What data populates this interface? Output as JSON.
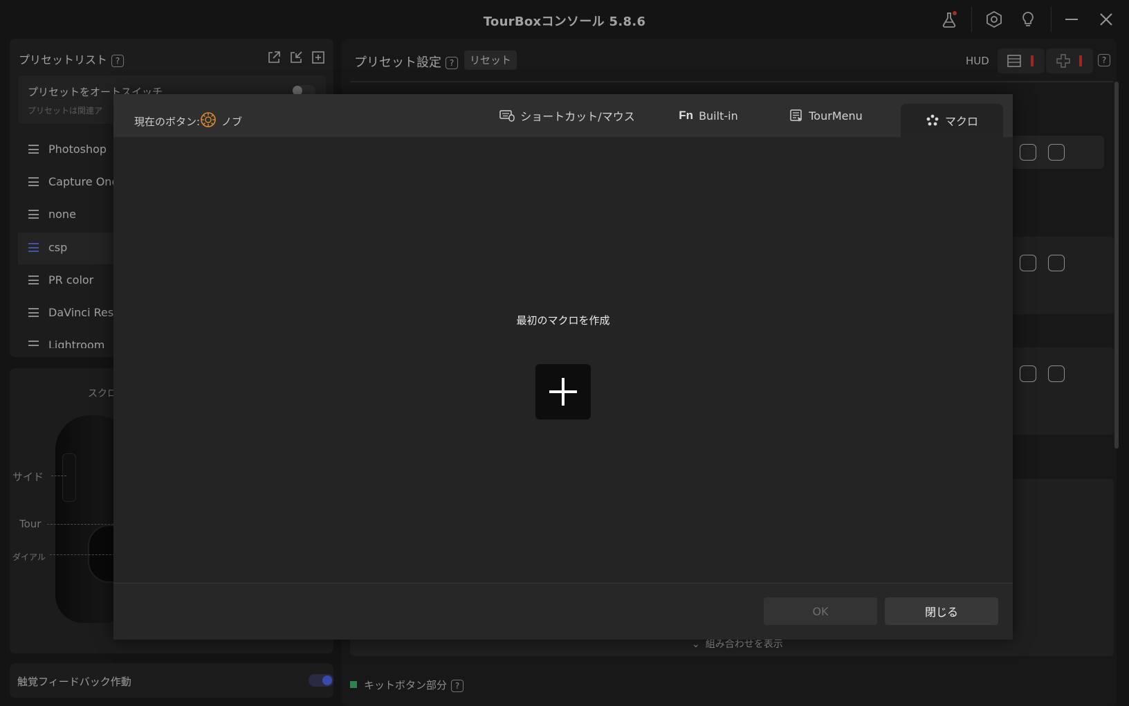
{
  "window": {
    "title": "TourBoxコンソール 5.8.6"
  },
  "preset_list": {
    "title": "プリセットリスト",
    "help": "?",
    "auto_switch": {
      "label": "プリセットをオートスイッチ",
      "description": "プリセットは関連ア"
    },
    "items": [
      {
        "label": "Photoshop"
      },
      {
        "label": "Capture One"
      },
      {
        "label": "none"
      },
      {
        "label": "csp"
      },
      {
        "label": "PR color"
      },
      {
        "label": "DaVinci Reso"
      },
      {
        "label": "Lightroom"
      }
    ]
  },
  "device": {
    "scroll_label": "スクロ",
    "side_label": "サイド",
    "tour_label": "Tour",
    "dial_label": "ダイアル"
  },
  "feedback": {
    "label": "触覚フィードバック作動"
  },
  "preset_settings": {
    "title": "プリセット設定",
    "help": "?",
    "reset_label": "リセット",
    "hud_label": "HUD",
    "hud_help": "?",
    "show_combos": "組み合わせを表示",
    "kit_section": "キットボタン部分",
    "kit_help": "?"
  },
  "modal": {
    "current_button_label": "現在のボタン:",
    "current_button_value": "ノブ",
    "tabs": [
      {
        "label": "ショートカット/マウス",
        "icon": "keyboard-mouse-icon"
      },
      {
        "label": "Built-in",
        "icon": "fn-icon"
      },
      {
        "label": "TourMenu",
        "icon": "tourmenu-icon"
      },
      {
        "label": "マクロ",
        "icon": "macro-icon"
      }
    ],
    "active_tab": "マクロ",
    "empty_message": "最初のマクロを作成",
    "ok_label": "OK",
    "close_label": "閉じる"
  },
  "colors": {
    "accent": "#4a63e8",
    "knob_icon": "#e0892f",
    "hud_indicator": "#d23333",
    "kit_indicator": "#3fae6a"
  }
}
